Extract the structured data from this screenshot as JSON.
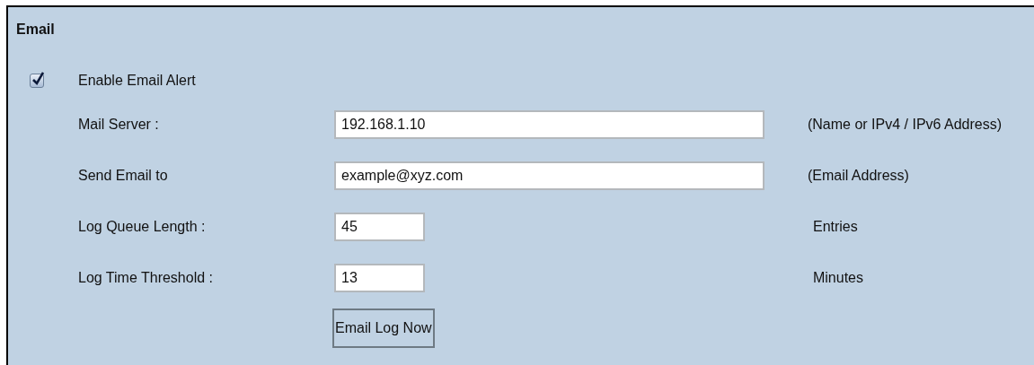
{
  "section": {
    "title": "Email"
  },
  "enable": {
    "label": "Enable Email Alert",
    "checked": true
  },
  "fields": [
    {
      "kind": "wide",
      "label": "Mail Server :",
      "value": "192.168.1.10",
      "hint": "(Name or IPv4 / IPv6 Address)"
    },
    {
      "kind": "wide",
      "label": "Send Email to",
      "value": "example@xyz.com",
      "hint": "(Email Address)"
    },
    {
      "kind": "narrow",
      "label": "Log Queue Length :",
      "value": "45",
      "hint": "Entries"
    },
    {
      "kind": "narrow",
      "label": "Log Time Threshold :",
      "value": "13",
      "hint": "Minutes"
    }
  ],
  "buttons": [
    "Email Log Now"
  ]
}
